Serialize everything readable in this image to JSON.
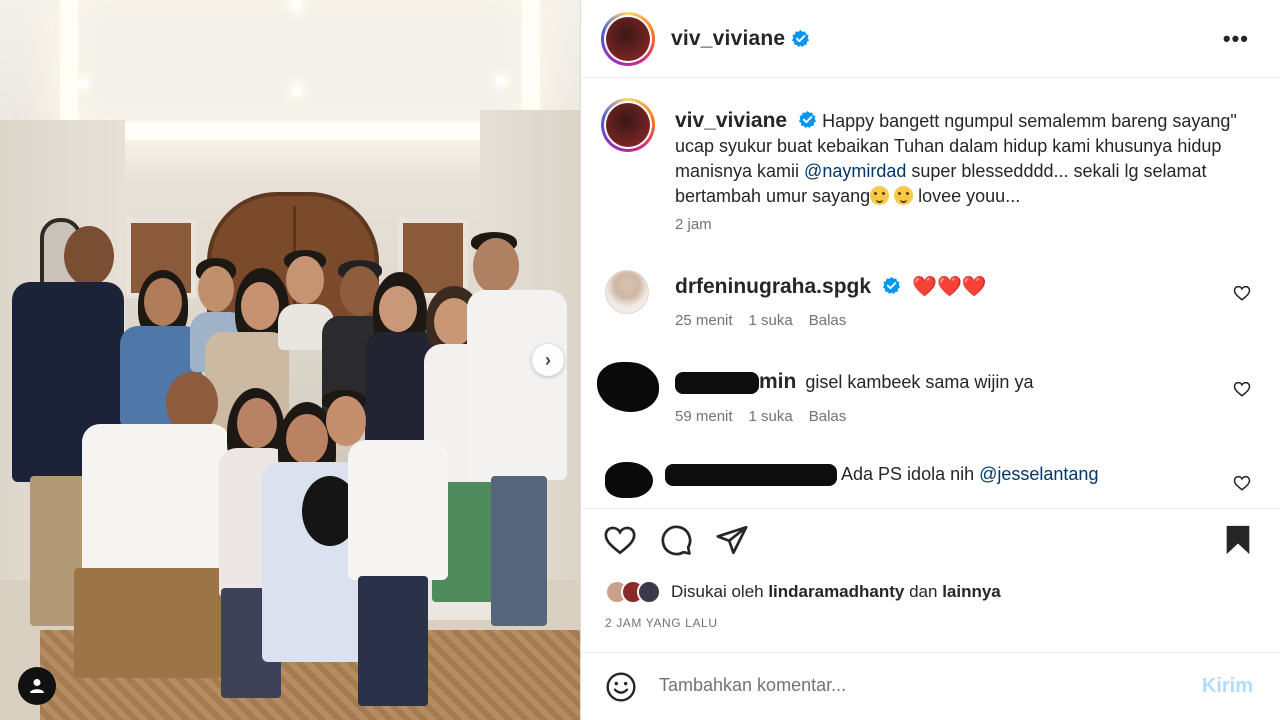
{
  "post": {
    "username": "viv_viviane",
    "more_label": "•••",
    "caption": {
      "text_before_mention": "Happy bangett ngumpul semalemm bareng sayang\" ucap syukur buat kebaikan Tuhan dalam hidup kami khusunya hidup manisnya kamii ",
      "mention": "@naymirdad",
      "text_after_mention": " super blessedddd... sekali lg selamat bertambah umur sayang",
      "text_end": " lovee youu...",
      "time": "2 jam"
    }
  },
  "comments": [
    {
      "username": "drfeninugraha.spgk",
      "verified": true,
      "text": "❤️❤️❤️",
      "time": "25 menit",
      "likes": "1 suka",
      "reply": "Balas"
    },
    {
      "username_visible": "min",
      "text": "gisel kambeek sama wijin ya",
      "time": "59 menit",
      "likes": "1 suka",
      "reply": "Balas"
    },
    {
      "text": "Ada PS idola nih ",
      "mention": "@jesselantang"
    }
  ],
  "likes": {
    "prefix": "Disukai oleh ",
    "user": "lindaramadhanty",
    "middle": " dan ",
    "suffix": "lainnya"
  },
  "timestamp": "2 JAM YANG LALU",
  "add_comment": {
    "placeholder": "Tambahkan komentar...",
    "post_label": "Kirim"
  },
  "colors": {
    "verified_blue": "#0095f6",
    "mention": "#00376b",
    "post_disabled": "#b3dbff",
    "heart_red": "#ed1c24"
  },
  "icons": [
    "next-arrow-icon",
    "tag-person-icon",
    "verified-icon",
    "more-icon",
    "heart-icon",
    "comment-icon",
    "share-icon",
    "bookmark-icon",
    "smiley-icon"
  ]
}
